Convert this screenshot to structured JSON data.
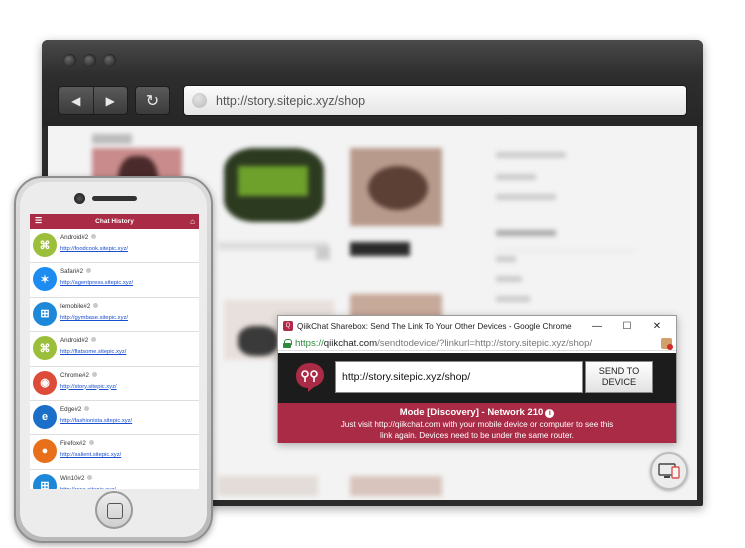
{
  "browser": {
    "url": "http://story.sitepic.xyz/shop"
  },
  "popup": {
    "window_title": "QiikChat Sharebox: Send The Link To Your Other Devices - Google Chrome",
    "address": {
      "scheme": "https://",
      "domain": "qiikchat.com",
      "path": "/sendtodevice/?linkurl=http://story.sitepic.xyz/shop/"
    },
    "link_value": "http://story.sitepic.xyz/shop/",
    "send_button": "SEND TO DEVICE",
    "mode": "Mode [Discovery] - Network 210",
    "help_text": "Just visit http://qiikchat.com with your mobile device or computer to see this link again. Devices need to be under the same router."
  },
  "phone": {
    "header_title": "Chat History",
    "chats": [
      {
        "name": "Android#2",
        "link": "http://foodcook.sitepic.xyz/",
        "icon": "android-icon",
        "color": "#9bbf3a"
      },
      {
        "name": "Safari#2",
        "link": "http://agentpress.sitepic.xyz/",
        "icon": "safari-icon",
        "color": "#1d8cf0"
      },
      {
        "name": "Iemobile#2",
        "link": "http://gymbase.sitepic.xyz/",
        "icon": "windows-icon",
        "color": "#1e88d8"
      },
      {
        "name": "Android#2",
        "link": "http://flatsome.sitepic.xyz/",
        "icon": "android-icon",
        "color": "#9bbf3a"
      },
      {
        "name": "Chrome#2",
        "link": "http://story.sitepic.xyz/",
        "icon": "chrome-icon",
        "color": "#dd4b39"
      },
      {
        "name": "Edge#2",
        "link": "http://fashionista.sitepic.xyz/",
        "icon": "edge-icon",
        "color": "#1b6fc8"
      },
      {
        "name": "Firefox#2",
        "link": "http://salient.sitepic.xyz/",
        "icon": "firefox-icon",
        "color": "#e8701a"
      },
      {
        "name": "Win10#2",
        "link": "http://rosa.sitepic.xyz/",
        "icon": "windows-icon",
        "color": "#1e88d8"
      }
    ]
  }
}
